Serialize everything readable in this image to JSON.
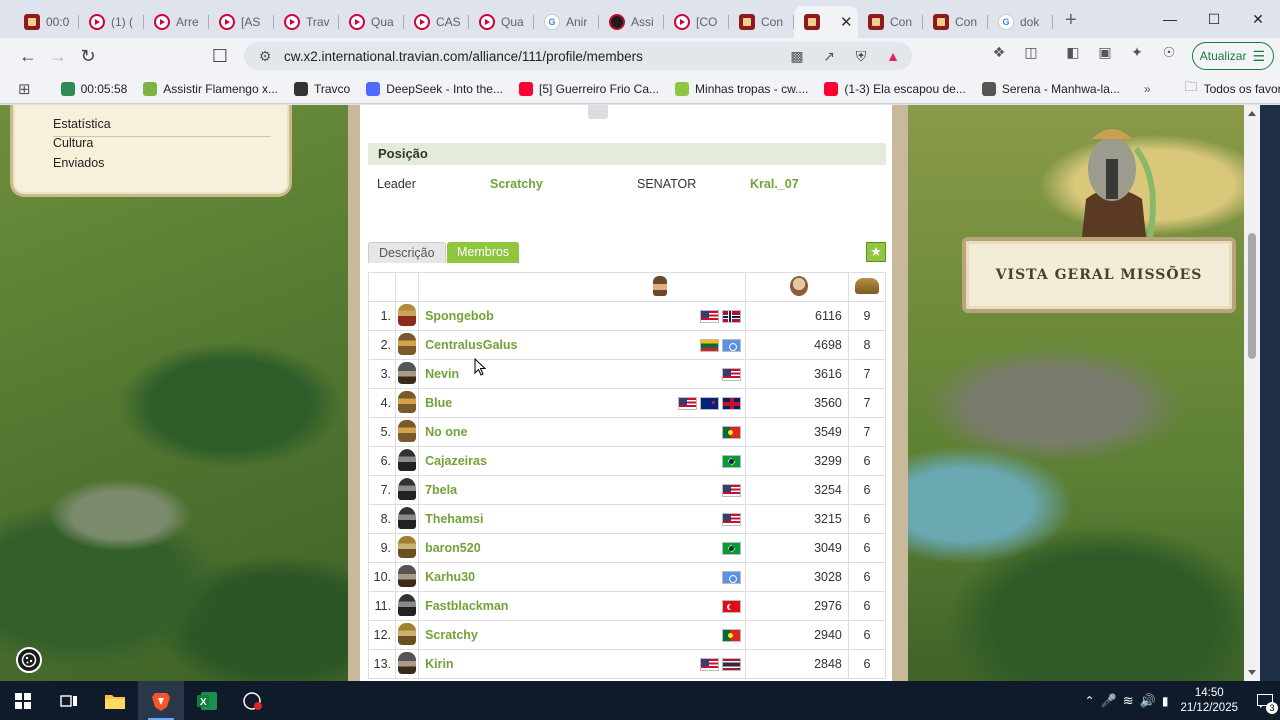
{
  "browser": {
    "tabs": [
      {
        "label": "00:0",
        "icon": "travian-clock-icon"
      },
      {
        "label": "(1) (",
        "icon": "youtube-icon"
      },
      {
        "label": "Arre",
        "icon": "youtube-icon"
      },
      {
        "label": "[AS",
        "icon": "youtube-icon"
      },
      {
        "label": "Trav",
        "icon": "youtube-icon"
      },
      {
        "label": "Qua",
        "icon": "youtube-icon"
      },
      {
        "label": "CAS",
        "icon": "youtube-icon"
      },
      {
        "label": "Qua",
        "icon": "youtube-icon"
      },
      {
        "label": "Anir",
        "icon": "google-icon"
      },
      {
        "label": "Assi",
        "icon": "media-icon"
      },
      {
        "label": "[CO",
        "icon": "youtube-icon"
      },
      {
        "label": "Con",
        "icon": "travian-icon"
      },
      {
        "label": "",
        "icon": "travian-icon",
        "active": true
      },
      {
        "label": "Con",
        "icon": "travian-icon"
      },
      {
        "label": "Con",
        "icon": "travian-icon"
      },
      {
        "label": "dok",
        "icon": "google-icon"
      }
    ],
    "url": "cw.x2.international.travian.com/alliance/111/profile/members",
    "update_label": "Atualizar",
    "bookmarks": [
      {
        "label": "00:05:58",
        "color": "#2e8b57"
      },
      {
        "label": "Assistir Flamengo x...",
        "color": "#7cb342"
      },
      {
        "label": "Travco",
        "color": "#333333"
      },
      {
        "label": "DeepSeek - Into the...",
        "color": "#4d6bfe"
      },
      {
        "label": "[5] Guerreiro Frio Ca...",
        "color": "#ff0033"
      },
      {
        "label": "Minhas tropas - cw....",
        "color": "#8ec63f"
      },
      {
        "label": "(1-3) Ela escapou de...",
        "color": "#ff0033"
      },
      {
        "label": "Serena - Manhwa-la...",
        "color": "#555555"
      }
    ],
    "all_bookmarks_label": "Todos os favoritos"
  },
  "left_menu": {
    "items": [
      "Estatística",
      "Cultura",
      "Enviados"
    ]
  },
  "mission": {
    "title": "VISTA GERAL MISSÕES"
  },
  "profile": {
    "section_title": "Posição",
    "positions": [
      {
        "role": "Leader",
        "name": "Scratchy"
      },
      {
        "role": "SENATOR",
        "name": "Kral._07"
      }
    ],
    "tabs": {
      "description": "Descrição",
      "members": "Membros"
    }
  },
  "members": [
    {
      "rank": "1.",
      "tribe": "roman",
      "name": "Spongebob",
      "flags": [
        "f-us",
        "f-no"
      ],
      "pop": "6116",
      "villages": "9"
    },
    {
      "rank": "2.",
      "tribe": "gaul",
      "name": "CentralusGalus",
      "flags": [
        "f-lt",
        "f-un"
      ],
      "pop": "4698",
      "villages": "8"
    },
    {
      "rank": "3.",
      "tribe": "teuton",
      "name": "Nevin",
      "flags": [
        "f-us"
      ],
      "pop": "3616",
      "villages": "7"
    },
    {
      "rank": "4.",
      "tribe": "gaul",
      "name": "Blue",
      "flags": [
        "f-us",
        "f-nz",
        "f-gb"
      ],
      "pop": "3560",
      "villages": "7"
    },
    {
      "rank": "5.",
      "tribe": "gaul",
      "name": "No one",
      "flags": [
        "f-pt"
      ],
      "pop": "3549",
      "villages": "7"
    },
    {
      "rank": "6.",
      "tribe": "hun",
      "name": "Cajazeiras",
      "flags": [
        "f-br"
      ],
      "pop": "3299",
      "villages": "6"
    },
    {
      "rank": "7.",
      "tribe": "hun",
      "name": "7bela",
      "flags": [
        "f-us"
      ],
      "pop": "3254",
      "villages": "6"
    },
    {
      "rank": "8.",
      "tribe": "hun",
      "name": "Thehamsi",
      "flags": [
        "f-us"
      ],
      "pop": "3215",
      "villages": "6"
    },
    {
      "rank": "9.",
      "tribe": "egypt",
      "name": "baron520",
      "flags": [
        "f-br"
      ],
      "pop": "3049",
      "villages": "6"
    },
    {
      "rank": "10.",
      "tribe": "teuton",
      "name": "Karhu30",
      "flags": [
        "f-un"
      ],
      "pop": "3028",
      "villages": "6"
    },
    {
      "rank": "11.",
      "tribe": "hun",
      "name": "Fastblackman",
      "flags": [
        "f-tr"
      ],
      "pop": "2976",
      "villages": "6"
    },
    {
      "rank": "12.",
      "tribe": "egypt",
      "name": "Scratchy",
      "flags": [
        "f-pt"
      ],
      "pop": "2940",
      "villages": "6"
    },
    {
      "rank": "13.",
      "tribe": "teuton",
      "name": "Kirin",
      "flags": [
        "f-us",
        "f-th"
      ],
      "pop": "2848",
      "villages": "6"
    }
  ],
  "taskbar": {
    "time": "14:50",
    "date": "21/12/2025",
    "notifications": "3"
  },
  "colors": {
    "link_green": "#71a33a",
    "tab_green": "#8ec63f"
  }
}
